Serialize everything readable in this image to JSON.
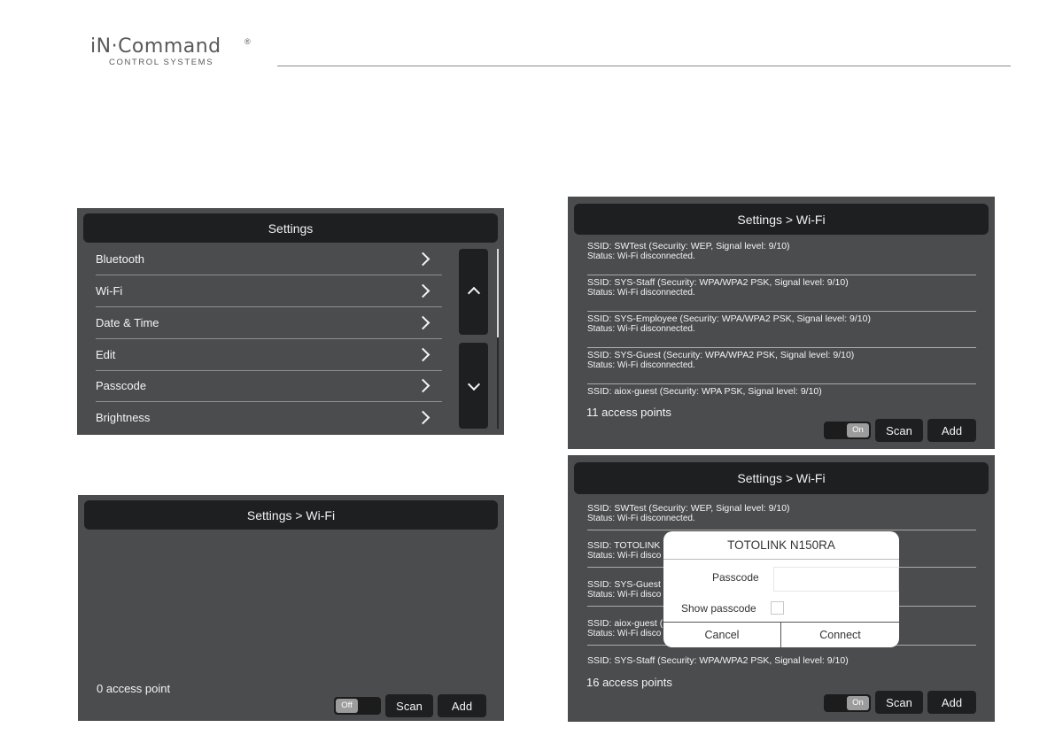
{
  "brand": {
    "logo_main": "iN·Command",
    "logo_registered": "®",
    "logo_sub": "CONTROL SYSTEMS"
  },
  "settings_screen": {
    "title": "Settings",
    "items": [
      {
        "label": "Bluetooth"
      },
      {
        "label": "Wi-Fi"
      },
      {
        "label": "Date & Time"
      },
      {
        "label": "Edit"
      },
      {
        "label": "Passcode"
      },
      {
        "label": "Brightness"
      }
    ]
  },
  "wifi_off_screen": {
    "title": "Settings > Wi-Fi",
    "count_text": "0 access point",
    "toggle_label": "Off",
    "scan_label": "Scan",
    "add_label": "Add"
  },
  "wifi_on_screen": {
    "title": "Settings > Wi-Fi",
    "access_points": [
      {
        "ssid": "SSID: SWTest (Security: WEP, Signal level: 9/10)",
        "status": "Status: Wi-Fi disconnected."
      },
      {
        "ssid": "SSID: SYS-Staff (Security: WPA/WPA2 PSK, Signal level: 9/10)",
        "status": "Status: Wi-Fi disconnected."
      },
      {
        "ssid": "SSID: SYS-Employee (Security: WPA/WPA2 PSK, Signal level: 9/10)",
        "status": "Status: Wi-Fi disconnected."
      },
      {
        "ssid": "SSID: SYS-Guest (Security: WPA/WPA2 PSK, Signal level: 9/10)",
        "status": "Status: Wi-Fi disconnected."
      },
      {
        "ssid": "SSID: aiox-guest (Security: WPA PSK, Signal level: 9/10)",
        "status": ""
      }
    ],
    "count_text": "11 access points",
    "toggle_label": "On",
    "scan_label": "Scan",
    "add_label": "Add"
  },
  "wifi_dialog_screen": {
    "title": "Settings > Wi-Fi",
    "access_points": [
      {
        "ssid": "SSID: SWTest (Security: WEP, Signal level: 9/10)",
        "status": "Status: Wi-Fi disconnected."
      },
      {
        "ssid": "SSID: TOTOLINK N",
        "status": "Status: Wi-Fi disco"
      },
      {
        "ssid": "SSID: SYS-Guest (",
        "status": "Status: Wi-Fi disco"
      },
      {
        "ssid": "SSID: aiox-guest (S",
        "status": "Status: Wi-Fi disco"
      },
      {
        "ssid": "SSID: SYS-Staff (Security: WPA/WPA2 PSK, Signal level: 9/10)",
        "status": ""
      }
    ],
    "count_text": "16 access points",
    "toggle_label": "On",
    "scan_label": "Scan",
    "add_label": "Add",
    "dialog": {
      "title": "TOTOLINK N150RA",
      "passcode_label": "Passcode",
      "passcode_value": "",
      "show_passcode_label": "Show passcode",
      "cancel_label": "Cancel",
      "connect_label": "Connect"
    }
  }
}
